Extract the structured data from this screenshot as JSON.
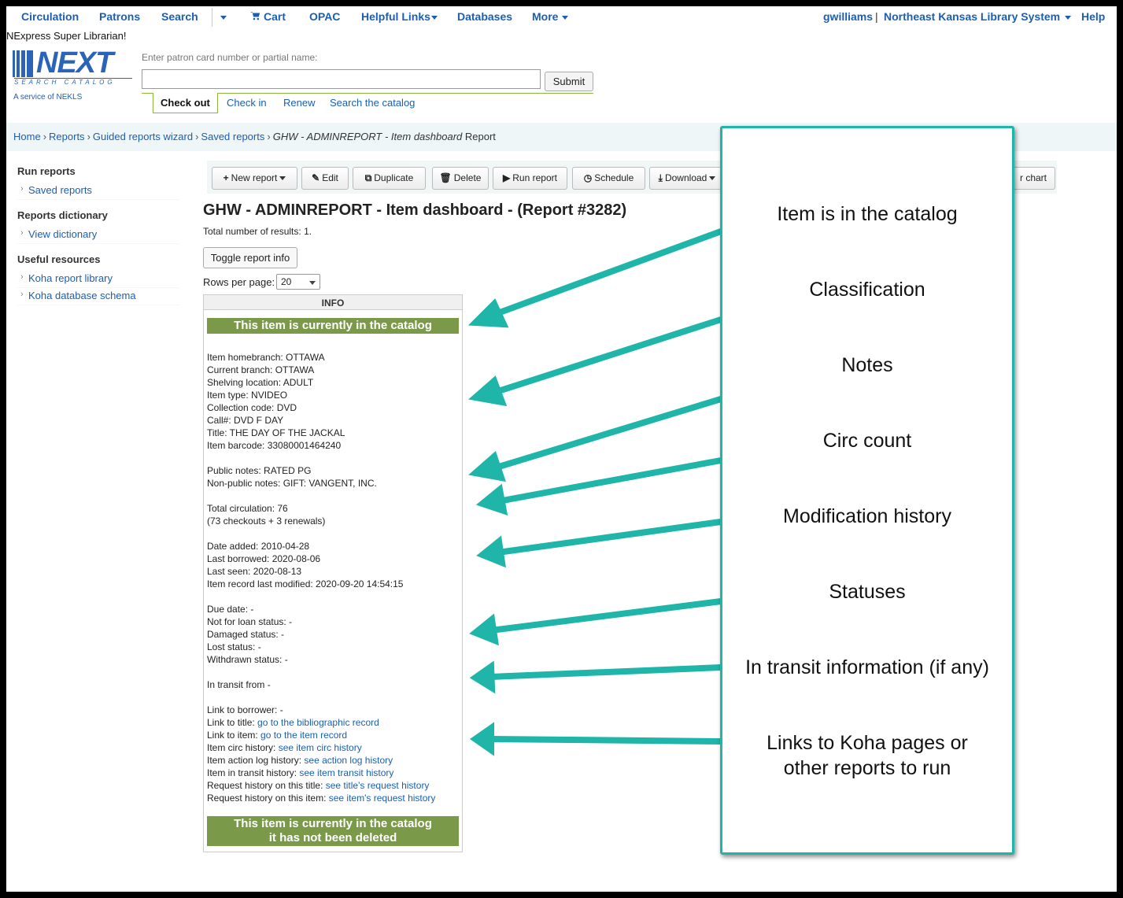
{
  "topnav": {
    "circulation": "Circulation",
    "patrons": "Patrons",
    "search": "Search",
    "cart": "Cart",
    "opac": "OPAC",
    "helpful_links": "Helpful Links",
    "databases": "Databases",
    "more": "More",
    "username": "gwilliams",
    "library": "Northeast Kansas Library System",
    "help": "Help"
  },
  "library_title": "NExpress Super Librarian!",
  "logo": {
    "word": "NEXT",
    "tagline": "SEARCH CATALOG",
    "service": "A service of NEKLS"
  },
  "patron_search": {
    "label": "Enter patron card number or partial name:",
    "value": "",
    "submit": "Submit"
  },
  "circ_tabs": [
    "Check out",
    "Check in",
    "Renew",
    "Search the catalog"
  ],
  "breadcrumb": {
    "home": "Home",
    "reports": "Reports",
    "wizard": "Guided reports wizard",
    "saved": "Saved reports",
    "current_italic": "GHW - ADMINREPORT - Item dashboard",
    "current_suffix": "Report"
  },
  "sidebar": {
    "run_reports": "Run reports",
    "saved_reports": "Saved reports",
    "reports_dictionary": "Reports dictionary",
    "view_dictionary": "View dictionary",
    "useful_resources": "Useful resources",
    "koha_report_library": "Koha report library",
    "koha_database_schema": "Koha database schema"
  },
  "toolbar": {
    "new_report": "New report",
    "edit": "Edit",
    "duplicate": "Duplicate",
    "delete": "Delete",
    "run_report": "Run report",
    "schedule": "Schedule",
    "download": "Download",
    "chart": "r chart"
  },
  "report": {
    "title": "GHW - ADMINREPORT - Item dashboard - (Report #3282)",
    "total_label": "Total number of results:",
    "total_value": "1.",
    "toggle_button": "Toggle report info",
    "rows_label": "Rows per page:",
    "rows_value": "20",
    "column_header": "INFO",
    "banner_top": "This item is currently in the catalog",
    "banner_bottom_line1": "This item is currently in the catalog",
    "banner_bottom_line2": "it has not been deleted"
  },
  "info_lines": [
    {
      "text": "Item homebranch: OTTAWA"
    },
    {
      "text": "Current branch: OTTAWA"
    },
    {
      "text": "Shelving location: ADULT"
    },
    {
      "text": "Item type: NVIDEO"
    },
    {
      "text": "Collection code: DVD"
    },
    {
      "text": "Call#:  DVD F DAY"
    },
    {
      "text": "Title: THE DAY OF THE JACKAL"
    },
    {
      "text": "Item barcode: 33080001464240"
    },
    {
      "gap": true
    },
    {
      "text": "Public notes: RATED PG"
    },
    {
      "text": "Non-public notes: GIFT: VANGENT, INC."
    },
    {
      "gap": true
    },
    {
      "text": "Total circulation: 76"
    },
    {
      "text": "(73 checkouts + 3 renewals)"
    },
    {
      "gap": true
    },
    {
      "text": "Date added: 2010-04-28"
    },
    {
      "text": "Last borrowed: 2020-08-06"
    },
    {
      "text": "Last seen: 2020-08-13"
    },
    {
      "text": "Item record last modified: 2020-09-20 14:54:15"
    },
    {
      "gap": true
    },
    {
      "text": "Due date: -"
    },
    {
      "text": "Not for loan status: -"
    },
    {
      "text": "Damaged status: -"
    },
    {
      "text": "Lost status: -"
    },
    {
      "text": "Withdrawn status: -"
    },
    {
      "gap": true
    },
    {
      "text": "In transit from -"
    },
    {
      "gap": true
    },
    {
      "text": "Link to borrower: -"
    },
    {
      "text": "Link to title: ",
      "link": "go to the bibliographic record"
    },
    {
      "text": "Link to item: ",
      "link": "go to the item record"
    },
    {
      "text": "Item circ history: ",
      "link": "see item circ history"
    },
    {
      "text": "Item action log history: ",
      "link": "see action log history"
    },
    {
      "text": "Item in transit history: ",
      "link": "see item transit history"
    },
    {
      "text": "Request history on this title: ",
      "link": "see title's request history"
    },
    {
      "text": "Request history on this item: ",
      "link": "see item's request history"
    }
  ],
  "annotations": [
    "Item is in the catalog",
    "Classification",
    "Notes",
    "Circ count",
    "Modification history",
    "Statuses",
    "In transit information (if any)",
    "Links to Koha pages or other reports to run"
  ],
  "colors": {
    "link": "#1a5fb4",
    "banner": "#7a9a4a",
    "accent_teal": "#1fb5a8",
    "tab_border": "#8ab83a"
  }
}
